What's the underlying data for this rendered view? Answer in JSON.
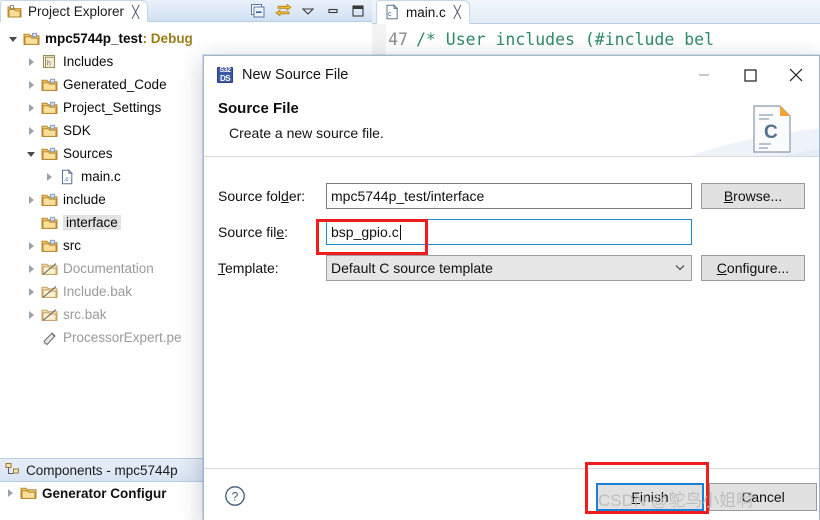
{
  "ide": {
    "explorer": {
      "tab_label": "Project Explorer",
      "tab_close": "╳",
      "toolbar": [
        {
          "name": "collapse-all-icon",
          "title": "Collapse All"
        },
        {
          "name": "link-with-editor-icon",
          "title": "Link with Editor"
        },
        {
          "name": "view-menu-icon",
          "title": "View Menu"
        },
        {
          "name": "minimize-icon",
          "title": "Minimize"
        },
        {
          "name": "maximize-icon",
          "title": "Maximize"
        }
      ],
      "tree": [
        {
          "label": "mpc5744p_test",
          "suffix": ": Debug",
          "indent": 0,
          "arrow": "down",
          "icon": "project-folder-icon",
          "style": "project"
        },
        {
          "label": "Includes",
          "indent": 1,
          "arrow": "right",
          "icon": "includes-icon",
          "style": "normal"
        },
        {
          "label": "Generated_Code",
          "indent": 1,
          "arrow": "right",
          "icon": "folder-icon",
          "style": "normal"
        },
        {
          "label": "Project_Settings",
          "indent": 1,
          "arrow": "right",
          "icon": "folder-icon",
          "style": "normal"
        },
        {
          "label": "SDK",
          "indent": 1,
          "arrow": "right",
          "icon": "folder-icon",
          "style": "normal"
        },
        {
          "label": "Sources",
          "indent": 1,
          "arrow": "down",
          "icon": "folder-icon",
          "style": "normal"
        },
        {
          "label": "main.c",
          "indent": 2,
          "arrow": "right",
          "icon": "c-file-icon",
          "style": "normal"
        },
        {
          "label": "include",
          "indent": 1,
          "arrow": "right",
          "icon": "folder-icon",
          "style": "normal"
        },
        {
          "label": "interface",
          "indent": 1,
          "arrow": "none",
          "icon": "folder-icon",
          "style": "selected"
        },
        {
          "label": "src",
          "indent": 1,
          "arrow": "right",
          "icon": "folder-icon",
          "style": "normal"
        },
        {
          "label": "Documentation",
          "indent": 1,
          "arrow": "right",
          "icon": "folder-excluded-icon",
          "style": "dim"
        },
        {
          "label": "Include.bak",
          "indent": 1,
          "arrow": "right",
          "icon": "folder-excluded-icon",
          "style": "dim"
        },
        {
          "label": "src.bak",
          "indent": 1,
          "arrow": "right",
          "icon": "folder-excluded-icon",
          "style": "dim"
        },
        {
          "label": "ProcessorExpert.pe",
          "indent": 1,
          "arrow": "none",
          "icon": "processor-expert-icon",
          "style": "dim"
        }
      ]
    },
    "components": {
      "tab_label": "Components - mpc5744p",
      "tab_icon": "components-icon",
      "first_row": "Generator Configur",
      "first_row_icon": "folder-icon"
    },
    "editor": {
      "tab_label": "main.c",
      "tab_icon": "c-file-icon",
      "tab_close": "╳",
      "line_number": "47",
      "code_text": "/* User includes (#include bel"
    }
  },
  "dialog": {
    "title": "New Source File",
    "title_icon": "s32ds-icon",
    "icon_text_top": "S32",
    "icon_text_bottom": "DS",
    "window_buttons": [
      {
        "name": "minimize-button",
        "glyph": "—"
      },
      {
        "name": "maximize-button",
        "glyph": "☐"
      },
      {
        "name": "close-button",
        "glyph": "✕"
      }
    ],
    "banner": {
      "heading": "Source File",
      "subtitle": "Create a new source file.",
      "image_icon": "c-source-file-icon",
      "image_letter": "C"
    },
    "fields": {
      "source_folder": {
        "label": "Source fol",
        "label_mnemonic": "d",
        "label_tail": "er:",
        "value": "mpc5744p_test/interface",
        "button": {
          "prefix": "",
          "mnemonic": "B",
          "tail": "rowse..."
        }
      },
      "source_file": {
        "label": "Source fil",
        "label_mnemonic": "e",
        "label_tail": ":",
        "value": "bsp_gpio.c"
      },
      "template": {
        "label": "",
        "label_mnemonic": "T",
        "label_tail": "emplate:",
        "value": "Default C source template",
        "chevron": "⌄",
        "button": {
          "prefix": "",
          "mnemonic": "C",
          "tail": "onfigure..."
        }
      }
    },
    "footer": {
      "help_icon": "help-icon",
      "finish": {
        "prefix": "",
        "mnemonic": "F",
        "tail": "inish"
      },
      "cancel": {
        "prefix": "",
        "mnemonic": "C",
        "tail": "ancel"
      }
    }
  },
  "watermark": "CSDN @鸵鸟小姐啊",
  "colors": {
    "red_annotation": "#f01d1d",
    "focus_blue": "#1b7fd4",
    "comment_green": "#2f8a6a",
    "config_gold": "#9a7d1a",
    "dialog_icon_blue": "#3b57a6"
  }
}
